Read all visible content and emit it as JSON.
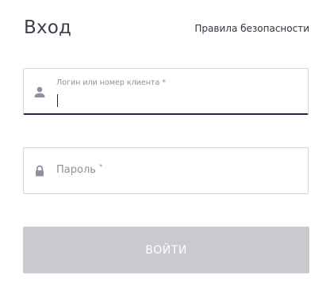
{
  "header": {
    "title": "Вход",
    "security_link": "Правила безопасности"
  },
  "login_field": {
    "label": "Логин или номер клиента *",
    "value": "",
    "icon": "user-icon"
  },
  "password_field": {
    "placeholder": "Пароль",
    "required_mark": "*",
    "icon": "lock-icon"
  },
  "submit": {
    "label": "ВОЙТИ"
  },
  "colors": {
    "text_dark": "#3c3f4d",
    "focus_border": "#232847",
    "field_border": "#d4d6dd",
    "muted_text": "#8e919b",
    "button_disabled": "#c9cacf"
  }
}
